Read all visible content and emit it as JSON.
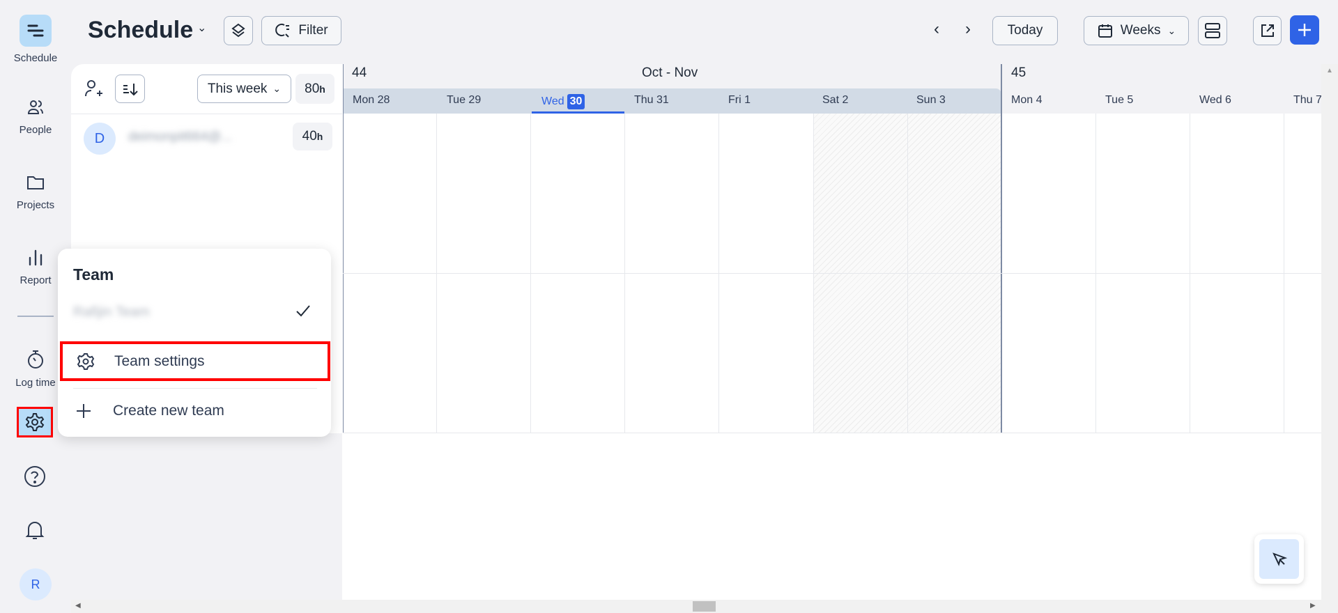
{
  "sidebar": {
    "items": [
      {
        "label": "Schedule",
        "icon": "schedule-icon",
        "active": true
      },
      {
        "label": "People",
        "icon": "people-icon"
      },
      {
        "label": "Projects",
        "icon": "folder-icon"
      },
      {
        "label": "Report",
        "icon": "bar-chart-icon"
      },
      {
        "label": "Log time",
        "icon": "stopwatch-icon"
      }
    ],
    "avatar": "R"
  },
  "header": {
    "title": "Schedule",
    "filter": "Filter",
    "today": "Today",
    "view": "Weeks"
  },
  "panel": {
    "range": "This week",
    "total": "80",
    "total_unit": "h",
    "people": [
      {
        "initial": "D",
        "name": "deimonpit664@...",
        "hours": "40",
        "unit": "h"
      }
    ]
  },
  "calendar": {
    "month": "Oct - Nov",
    "weeks": [
      "44",
      "45"
    ],
    "today_label": "Wed",
    "today_num": "30",
    "days": [
      "Mon 28",
      "Tue 29",
      "Wed 30",
      "Thu 31",
      "Fri 1",
      "Sat 2",
      "Sun 3",
      "Mon 4",
      "Tue 5",
      "Wed 6",
      "Thu 7"
    ]
  },
  "menu": {
    "title": "Team",
    "team_name": "Rafijin Team",
    "settings": "Team settings",
    "create": "Create new team"
  },
  "colors": {
    "accent": "#2f63e6",
    "highlight": "#ff0000",
    "active_bg": "#b7dcf8"
  }
}
